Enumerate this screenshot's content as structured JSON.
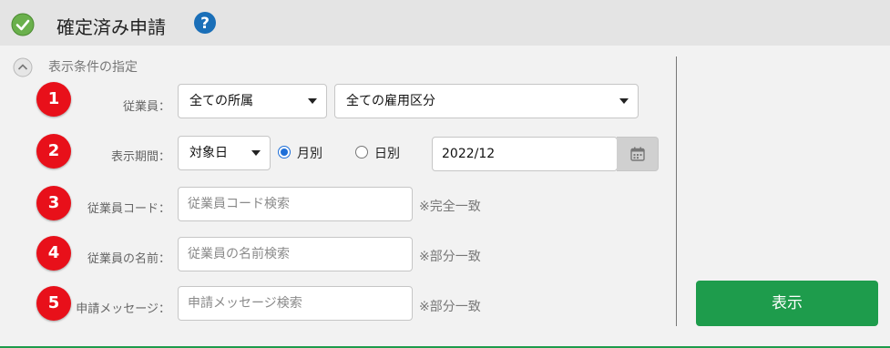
{
  "header": {
    "title": "確定済み申請",
    "check_icon": "check-circle-icon",
    "help_icon": "question-circle-icon"
  },
  "filter": {
    "section_title": "表示条件の指定",
    "toggle_icon": "chevron-up-icon",
    "badges": [
      "1",
      "2",
      "3",
      "4",
      "5"
    ],
    "employee": {
      "label": "従業員：",
      "department_value": "全ての所属",
      "employment_type_value": "全ての雇用区分"
    },
    "period": {
      "label": "表示期間：",
      "date_type_value": "対象日",
      "radio_month": "月別",
      "radio_day": "日別",
      "selected": "月別",
      "date_value": "2022/12",
      "calendar_icon": "calendar-icon"
    },
    "employee_code": {
      "label": "従業員コード：",
      "placeholder": "従業員コード検索",
      "note": "※完全一致"
    },
    "employee_name": {
      "label": "従業員の名前：",
      "placeholder": "従業員の名前検索",
      "note": "※部分一致"
    },
    "message": {
      "label": "申請メッセージ：",
      "placeholder": "申請メッセージ検索",
      "note": "※部分一致"
    },
    "submit_label": "表示"
  },
  "colors": {
    "accent_green": "#1e9c4c",
    "badge_red": "#e8101a",
    "help_blue": "#1a6fb8",
    "radio_blue": "#1e6fd8"
  }
}
